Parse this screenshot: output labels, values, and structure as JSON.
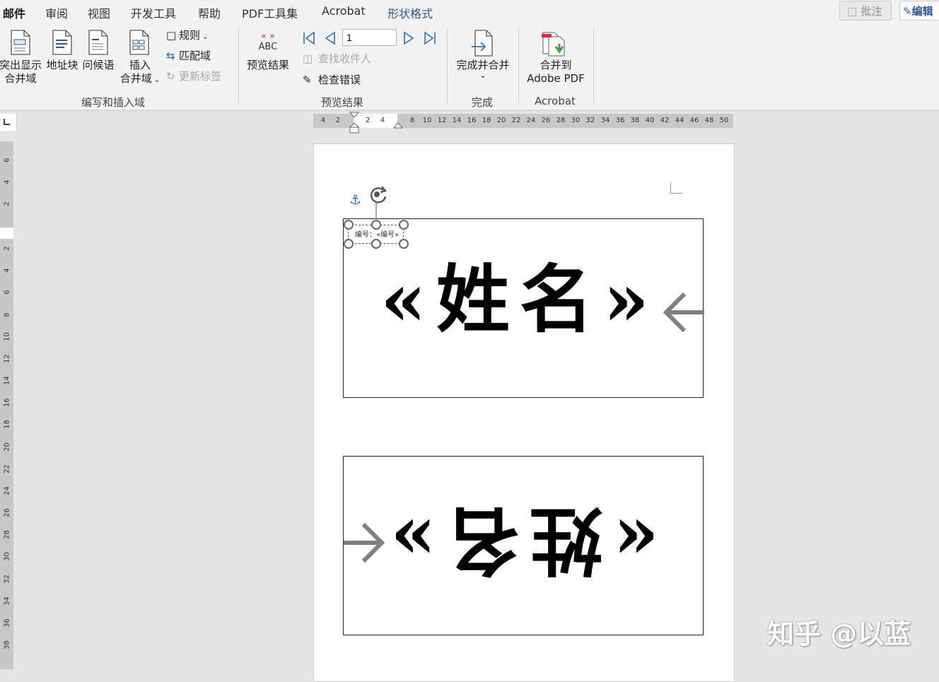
{
  "tabs": [
    {
      "label": "邮件",
      "active": true
    },
    {
      "label": "审阅"
    },
    {
      "label": "视图"
    },
    {
      "label": "开发工具"
    },
    {
      "label": "帮助"
    },
    {
      "label": "PDF工具集"
    },
    {
      "label": "Acrobat"
    },
    {
      "label": "形状格式"
    }
  ],
  "top_right": {
    "comment": "批注",
    "edit": "编辑"
  },
  "ribbon": {
    "highlight_fields": [
      "突出显示",
      "合并域"
    ],
    "address_block": "地址块",
    "greeting": "问候语",
    "insert_field": [
      "插入",
      "合并域"
    ],
    "rules": "规则",
    "match_fields": "匹配域",
    "update_labels": "更新标签",
    "group_write": "编写和插入域",
    "preview_results": "预览结果",
    "abc": "ABC",
    "record_number": "1",
    "find_recipient": "查找收件人",
    "check_errors": "检查错误",
    "group_preview": "预览结果",
    "finish_merge": "完成并合并",
    "group_finish": "完成",
    "merge_to_pdf": [
      "合并到",
      "Adobe PDF"
    ],
    "group_acrobat": "Acrobat"
  },
  "ruler": {
    "horizontal": [
      "4",
      "2",
      "2",
      "4",
      "8",
      "10",
      "12",
      "14",
      "16",
      "18",
      "20",
      "22",
      "24",
      "26",
      "28",
      "30",
      "32",
      "34",
      "36",
      "38",
      "40",
      "42",
      "44",
      "46",
      "48",
      "50"
    ],
    "vertical": [
      "6",
      "4",
      "2",
      "2",
      "4",
      "6",
      "8",
      "10",
      "12",
      "14",
      "16",
      "18",
      "20",
      "22",
      "24",
      "26",
      "28",
      "30",
      "32",
      "34",
      "36",
      "38"
    ]
  },
  "document": {
    "number_field": "编号：«编号»",
    "card1_text": "«姓名»",
    "card2_text": "«姓名»"
  },
  "watermark": "知乎 @以蓝",
  "colors": {
    "accent": "#2b579a",
    "preview_red": "#c0392b",
    "nav_blue": "#2e75b6"
  }
}
